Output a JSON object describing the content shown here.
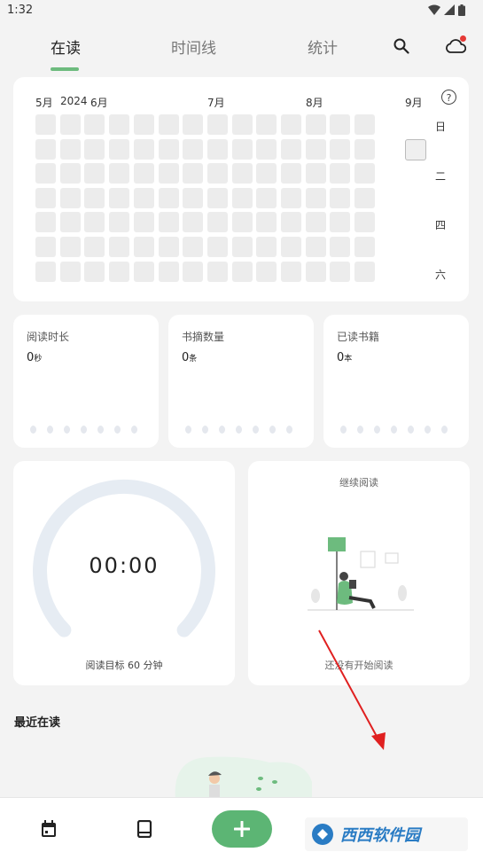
{
  "status_bar": {
    "time": "1:32"
  },
  "nav": {
    "tabs": [
      {
        "label": "在读",
        "active": true
      },
      {
        "label": "时间线",
        "active": false
      },
      {
        "label": "统计",
        "active": false
      }
    ],
    "search_icon": "search-icon",
    "cloud_icon": "cloud-icon"
  },
  "heatmap": {
    "months": [
      "5月",
      "2024",
      "6月",
      "7月",
      "8月",
      "9月"
    ],
    "weekdays": [
      "日",
      "二",
      "四",
      "六"
    ],
    "help_glyph": "?"
  },
  "stats": [
    {
      "label": "阅读时长",
      "value": "0",
      "unit": "秒"
    },
    {
      "label": "书摘数量",
      "value": "0",
      "unit": "条"
    },
    {
      "label": "已读书籍",
      "value": "0",
      "unit": "本"
    }
  ],
  "timer": {
    "time": "00:00",
    "goal": "阅读目标 60 分钟",
    "progress": 0
  },
  "continue_reading": {
    "title": "继续阅读",
    "empty": "还没有开始阅读"
  },
  "recent": {
    "title": "最近在读"
  },
  "bottom_bar": {
    "fab_label": "+"
  },
  "watermark": {
    "text": "西西软件园"
  },
  "colors": {
    "accent": "#5cb574",
    "notification": "#e53935",
    "annotation_arrow": "#e02020"
  }
}
